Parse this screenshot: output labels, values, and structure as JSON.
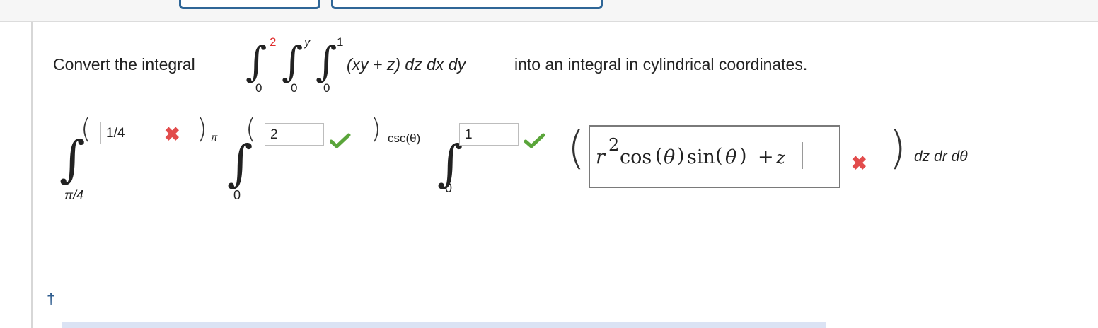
{
  "question": {
    "prefix": "Convert the integral",
    "integrand": "(xy + z) dz dx dy",
    "suffix": "into an integral in cylindrical coordinates.",
    "integrals": [
      {
        "upper": "2",
        "lower": "0"
      },
      {
        "upper": "y",
        "lower": "0"
      },
      {
        "upper": "1",
        "lower": "0"
      }
    ]
  },
  "answer": {
    "outer": {
      "lower": "π/4",
      "upper_value": "1/4",
      "upper_suffix": "π",
      "status": "incorrect"
    },
    "middle": {
      "lower": "0",
      "upper_value": "2",
      "upper_suffix": "csc(θ)",
      "status": "correct"
    },
    "inner": {
      "lower": "0",
      "upper_value": "1",
      "status": "correct"
    },
    "integrand": {
      "r": "r",
      "exp": "2",
      "cos": "cos",
      "theta1": "θ",
      "sin": "sin",
      "theta2": "θ",
      "plus": "+",
      "z": "z",
      "status": "incorrect"
    },
    "differentials": "dz dr dθ"
  },
  "footer": {
    "dagger": "†"
  },
  "colors": {
    "accent": "#2f6697",
    "incorrect": "#e24c4c",
    "correct": "#5aa53a",
    "link": "#2f5d8f"
  }
}
